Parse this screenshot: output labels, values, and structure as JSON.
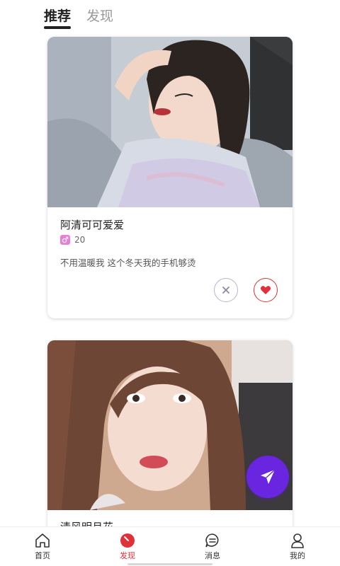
{
  "tabs": [
    {
      "label": "推荐",
      "active": true
    },
    {
      "label": "发现",
      "active": false
    }
  ],
  "cards": [
    {
      "name": "阿清可可爱爱",
      "gender_icon": "male-symbol-icon",
      "age": "20",
      "bio": "不用温暖我  这个冬天我的手机够烫",
      "photo": "woman-selfie-gray-sofa"
    },
    {
      "name": "清风明月花",
      "photo": "woman-closeup-car-seat"
    }
  ],
  "actions": {
    "dismiss_icon": "close-icon",
    "like_icon": "heart-icon",
    "fab_icon": "send-arrow-icon"
  },
  "bottom_nav": [
    {
      "label": "首页",
      "icon": "home-icon",
      "active": false
    },
    {
      "label": "发现",
      "icon": "compass-icon",
      "active": true
    },
    {
      "label": "消息",
      "icon": "chat-bubble-icon",
      "active": false
    },
    {
      "label": "我的",
      "icon": "user-icon",
      "active": false
    }
  ],
  "colors": {
    "accent": "#e0303a",
    "fab": "#6a25e0",
    "gender_badge": "#e97ed8"
  }
}
